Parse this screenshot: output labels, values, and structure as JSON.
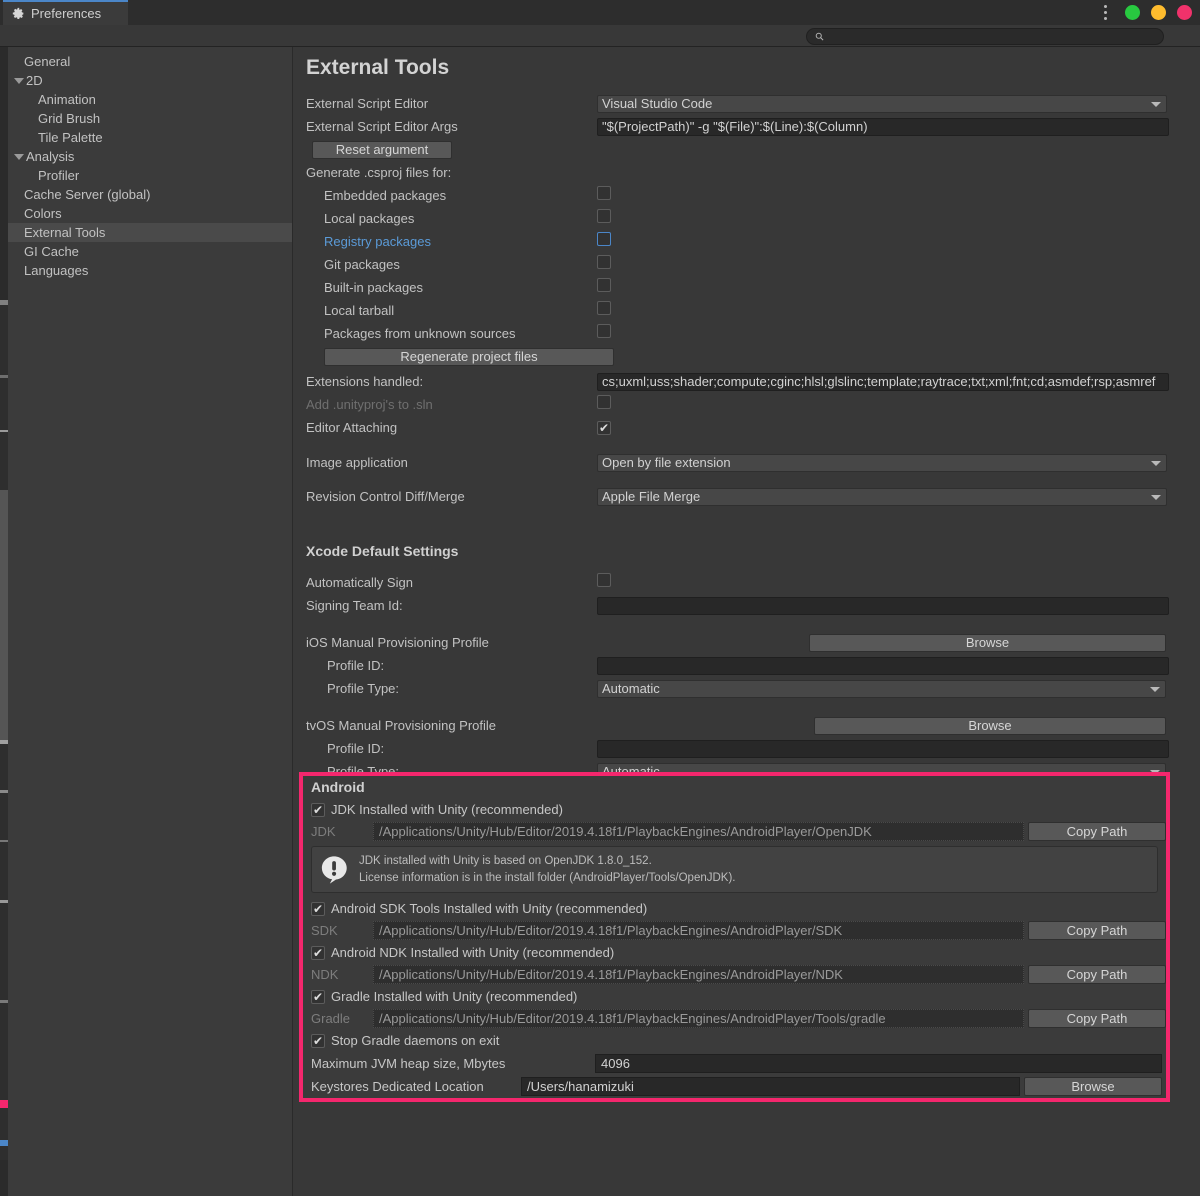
{
  "window": {
    "tab_label": "Preferences",
    "tab_icon": "gear-icon",
    "menu_icon": "kebab-menu-icon",
    "buttons": [
      "minimize-green",
      "maximize-yellow",
      "close-red"
    ]
  },
  "search": {
    "value": "",
    "placeholder": "",
    "icon": "search-icon"
  },
  "sidebar": {
    "items": [
      {
        "label": "General",
        "indent": 1,
        "expander": false,
        "selected": false
      },
      {
        "label": "2D",
        "indent": 0,
        "expander": true,
        "selected": false
      },
      {
        "label": "Animation",
        "indent": 2,
        "expander": false,
        "selected": false
      },
      {
        "label": "Grid Brush",
        "indent": 2,
        "expander": false,
        "selected": false
      },
      {
        "label": "Tile Palette",
        "indent": 2,
        "expander": false,
        "selected": false
      },
      {
        "label": "Analysis",
        "indent": 0,
        "expander": true,
        "selected": false
      },
      {
        "label": "Profiler",
        "indent": 2,
        "expander": false,
        "selected": false
      },
      {
        "label": "Cache Server (global)",
        "indent": 1,
        "expander": false,
        "selected": false
      },
      {
        "label": "Colors",
        "indent": 1,
        "expander": false,
        "selected": false
      },
      {
        "label": "External Tools",
        "indent": 1,
        "expander": false,
        "selected": true
      },
      {
        "label": "GI Cache",
        "indent": 1,
        "expander": false,
        "selected": false
      },
      {
        "label": "Languages",
        "indent": 1,
        "expander": false,
        "selected": false
      }
    ]
  },
  "main": {
    "title": "External Tools",
    "script_editor": {
      "label": "External Script Editor",
      "value": "Visual Studio Code"
    },
    "script_editor_args": {
      "label": "External Script Editor Args",
      "value": "\"$(ProjectPath)\" -g \"$(File)\":$(Line):$(Column)"
    },
    "reset_argument_button": "Reset argument",
    "generate_csproj_label": "Generate .csproj files for:",
    "csproj_options": [
      {
        "label": "Embedded packages",
        "checked": false,
        "focused": false
      },
      {
        "label": "Local packages",
        "checked": false,
        "focused": false
      },
      {
        "label": "Registry packages",
        "checked": false,
        "focused": true
      },
      {
        "label": "Git packages",
        "checked": false,
        "focused": false
      },
      {
        "label": "Built-in packages",
        "checked": false,
        "focused": false
      },
      {
        "label": "Local tarball",
        "checked": false,
        "focused": false
      },
      {
        "label": "Packages from unknown sources",
        "checked": false,
        "focused": false
      }
    ],
    "regenerate_button": "Regenerate project files",
    "extensions": {
      "label": "Extensions handled:",
      "value": "cs;uxml;uss;shader;compute;cginc;hlsl;glslinc;template;raytrace;txt;xml;fnt;cd;asmdef;rsp;asmref"
    },
    "add_unityproj": {
      "label": "Add .unityproj's to .sln",
      "checked": false
    },
    "editor_attaching": {
      "label": "Editor Attaching",
      "checked": true
    },
    "image_application": {
      "label": "Image application",
      "value": "Open by file extension"
    },
    "revision_control": {
      "label": "Revision Control Diff/Merge",
      "value": "Apple File Merge"
    },
    "xcode": {
      "heading": "Xcode Default Settings",
      "auto_sign": {
        "label": "Automatically Sign",
        "checked": false
      },
      "signing_team_id": {
        "label": "Signing Team Id:",
        "value": ""
      },
      "ios_profile": {
        "label": "iOS Manual Provisioning Profile",
        "browse": "Browse",
        "profile_id_label": "Profile ID:",
        "profile_id_value": "",
        "profile_type_label": "Profile Type:",
        "profile_type_value": "Automatic"
      },
      "tvos_profile": {
        "label": "tvOS Manual Provisioning Profile",
        "browse": "Browse",
        "profile_id_label": "Profile ID:",
        "profile_id_value": "",
        "profile_type_label": "Profile Type:",
        "profile_type_value": "Automatic"
      }
    },
    "android": {
      "heading": "Android",
      "highlight_color": "#f4276d",
      "jdk": {
        "checkbox_label": "JDK Installed with Unity (recommended)",
        "checked": true,
        "key": "JDK",
        "path": "/Applications/Unity/Hub/Editor/2019.4.18f1/PlaybackEngines/AndroidPlayer/OpenJDK",
        "copy_button": "Copy Path"
      },
      "info": {
        "icon": "warning-exclamation-icon",
        "line1": "JDK installed with Unity is based on OpenJDK 1.8.0_152.",
        "line2": "License information is in the install folder (AndroidPlayer/Tools/OpenJDK)."
      },
      "sdk": {
        "checkbox_label": "Android SDK Tools Installed with Unity (recommended)",
        "checked": true,
        "key": "SDK",
        "path": "/Applications/Unity/Hub/Editor/2019.4.18f1/PlaybackEngines/AndroidPlayer/SDK",
        "copy_button": "Copy Path"
      },
      "ndk": {
        "checkbox_label": "Android NDK Installed with Unity (recommended)",
        "checked": true,
        "key": "NDK",
        "path": "/Applications/Unity/Hub/Editor/2019.4.18f1/PlaybackEngines/AndroidPlayer/NDK",
        "copy_button": "Copy Path"
      },
      "gradle": {
        "checkbox_label": "Gradle Installed with Unity (recommended)",
        "checked": true,
        "key": "Gradle",
        "path": "/Applications/Unity/Hub/Editor/2019.4.18f1/PlaybackEngines/AndroidPlayer/Tools/gradle",
        "copy_button": "Copy Path"
      },
      "stop_daemons": {
        "label": "Stop Gradle daemons on exit",
        "checked": true
      },
      "jvm_heap": {
        "label": "Maximum JVM heap size, Mbytes",
        "value": "4096"
      },
      "keystores": {
        "label": "Keystores Dedicated Location",
        "value": "/Users/hanamizuki",
        "browse": "Browse"
      }
    }
  }
}
